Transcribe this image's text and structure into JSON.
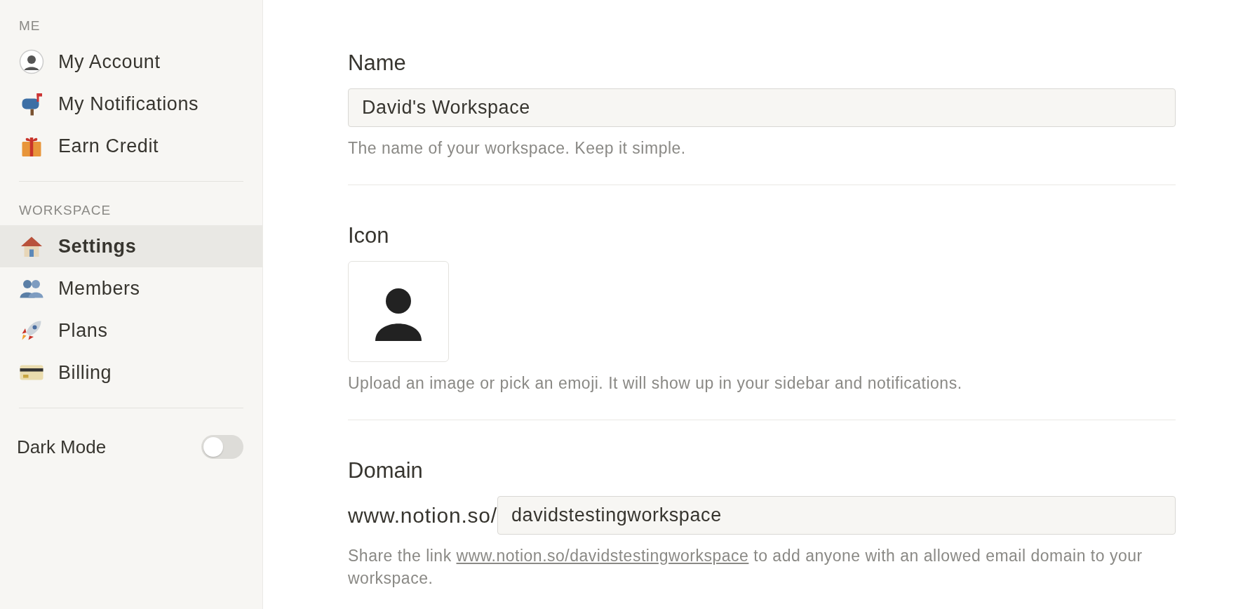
{
  "sidebar": {
    "sections": [
      {
        "heading": "ME",
        "items": [
          {
            "label": "My Account",
            "kind": "avatar",
            "selected": false
          },
          {
            "label": "My Notifications",
            "kind": "mailbox",
            "selected": false
          },
          {
            "label": "Earn Credit",
            "kind": "gift",
            "selected": false
          }
        ]
      },
      {
        "heading": "WORKSPACE",
        "items": [
          {
            "label": "Settings",
            "kind": "house",
            "selected": true
          },
          {
            "label": "Members",
            "kind": "people",
            "selected": false
          },
          {
            "label": "Plans",
            "kind": "rocket",
            "selected": false
          },
          {
            "label": "Billing",
            "kind": "card",
            "selected": false
          }
        ]
      }
    ],
    "dark_mode": {
      "label": "Dark Mode",
      "on": false
    }
  },
  "form": {
    "name": {
      "heading": "Name",
      "value": "David's Workspace",
      "help": "The name of your workspace. Keep it simple."
    },
    "icon": {
      "heading": "Icon",
      "help": "Upload an image or pick an emoji. It will show up in your sidebar and notifications."
    },
    "domain": {
      "heading": "Domain",
      "prefix": "www.notion.so/",
      "value": "davidstestingworkspace",
      "help_before": "Share the link ",
      "link": "www.notion.so/davidstestingworkspace",
      "help_after": " to add anyone with an allowed email domain to your workspace."
    }
  }
}
